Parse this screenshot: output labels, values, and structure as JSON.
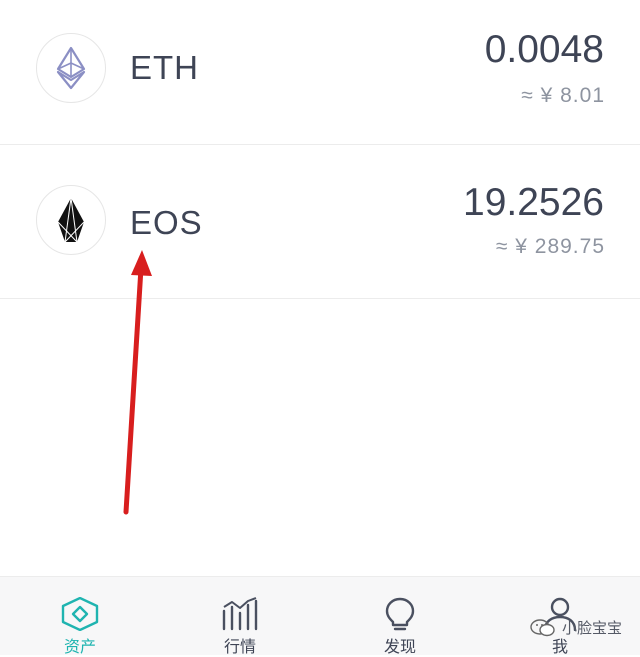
{
  "assets": [
    {
      "symbol": "ETH",
      "amount": "0.0048",
      "value": "≈ ¥ 8.01",
      "icon": "ethereum-icon"
    },
    {
      "symbol": "EOS",
      "amount": "19.2526",
      "value": "≈ ¥ 289.75",
      "icon": "eos-icon"
    }
  ],
  "tabs": [
    {
      "label": "资产",
      "icon": "assets-diamond-icon",
      "active": true
    },
    {
      "label": "行情",
      "icon": "market-chart-icon",
      "active": false
    },
    {
      "label": "发现",
      "icon": "discover-bulb-icon",
      "active": false
    },
    {
      "label": "我",
      "icon": "profile-person-icon",
      "active": false
    }
  ],
  "watermark": "小脸宝宝",
  "colors": {
    "accent": "#1fb4b0",
    "text_primary": "#3e4455",
    "text_secondary": "#8e94a0",
    "annotation_arrow": "#d81e1e"
  }
}
